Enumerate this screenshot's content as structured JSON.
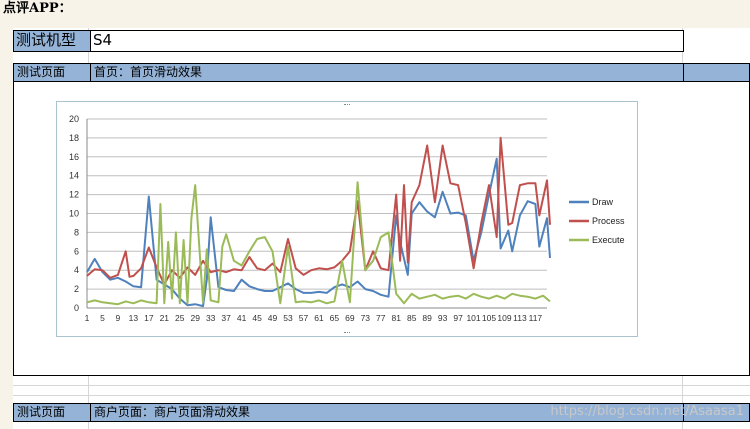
{
  "heading": "点评APP：",
  "table": {
    "model_label": "测试机型",
    "model_value": "S4",
    "page1_label": "测试页面",
    "page1_value": "首页：首页滑动效果",
    "page2_label": "测试页面",
    "page2_value": "商户页面：商户页面滑动效果"
  },
  "watermark": "https://blog.csdn.net/Asaasa1",
  "chart_data": {
    "type": "line",
    "title": "",
    "xlabel": "",
    "ylabel": "",
    "ylim": [
      0,
      20
    ],
    "yticks": [
      0,
      2,
      4,
      6,
      8,
      10,
      12,
      14,
      16,
      18,
      20
    ],
    "xlim": [
      1,
      120
    ],
    "xticks": [
      1,
      5,
      9,
      13,
      17,
      21,
      25,
      29,
      33,
      37,
      41,
      45,
      49,
      53,
      57,
      61,
      65,
      69,
      73,
      77,
      81,
      85,
      89,
      93,
      97,
      101,
      105,
      109,
      113,
      117
    ],
    "grid": true,
    "legend": "right",
    "series": [
      {
        "name": "Draw",
        "color": "#4f81bd",
        "points": [
          [
            1,
            3.8
          ],
          [
            3,
            5.2
          ],
          [
            5,
            3.8
          ],
          [
            7,
            3.0
          ],
          [
            9,
            3.2
          ],
          [
            11,
            2.8
          ],
          [
            13,
            2.3
          ],
          [
            15,
            2.2
          ],
          [
            17,
            11.8
          ],
          [
            19,
            3.0
          ],
          [
            21,
            2.5
          ],
          [
            23,
            2.0
          ],
          [
            25,
            1.0
          ],
          [
            27,
            0.3
          ],
          [
            29,
            0.4
          ],
          [
            31,
            0.2
          ],
          [
            32,
            3.0
          ],
          [
            33,
            9.6
          ],
          [
            35,
            2.2
          ],
          [
            37,
            1.9
          ],
          [
            39,
            1.8
          ],
          [
            41,
            3.0
          ],
          [
            43,
            2.3
          ],
          [
            45,
            2.0
          ],
          [
            47,
            1.8
          ],
          [
            49,
            1.8
          ],
          [
            51,
            2.2
          ],
          [
            53,
            2.6
          ],
          [
            55,
            2.0
          ],
          [
            57,
            1.6
          ],
          [
            59,
            1.6
          ],
          [
            61,
            1.7
          ],
          [
            63,
            1.6
          ],
          [
            65,
            2.2
          ],
          [
            67,
            2.5
          ],
          [
            69,
            2.2
          ],
          [
            71,
            2.8
          ],
          [
            73,
            2.0
          ],
          [
            75,
            1.8
          ],
          [
            77,
            1.4
          ],
          [
            79,
            1.2
          ],
          [
            81,
            9.8
          ],
          [
            82,
            7.0
          ],
          [
            84,
            3.5
          ],
          [
            85,
            10.0
          ],
          [
            87,
            11.2
          ],
          [
            89,
            10.2
          ],
          [
            91,
            9.6
          ],
          [
            93,
            12.3
          ],
          [
            95,
            10.0
          ],
          [
            97,
            10.1
          ],
          [
            99,
            9.8
          ],
          [
            101,
            5.0
          ],
          [
            103,
            8.0
          ],
          [
            105,
            12.0
          ],
          [
            107,
            15.8
          ],
          [
            108,
            6.3
          ],
          [
            110,
            8.2
          ],
          [
            111,
            6.0
          ],
          [
            113,
            9.8
          ],
          [
            115,
            11.3
          ],
          [
            117,
            11.0
          ],
          [
            118,
            6.5
          ],
          [
            120,
            9.5
          ],
          [
            121,
            5.3
          ]
        ]
      },
      {
        "name": "Process",
        "color": "#c0504d",
        "points": [
          [
            1,
            3.4
          ],
          [
            3,
            4.1
          ],
          [
            5,
            4.0
          ],
          [
            7,
            3.2
          ],
          [
            9,
            3.5
          ],
          [
            11,
            6.0
          ],
          [
            12,
            3.3
          ],
          [
            13,
            3.4
          ],
          [
            15,
            4.2
          ],
          [
            17,
            6.4
          ],
          [
            19,
            4.3
          ],
          [
            21,
            2.5
          ],
          [
            23,
            4.0
          ],
          [
            25,
            3.2
          ],
          [
            27,
            4.3
          ],
          [
            29,
            3.5
          ],
          [
            31,
            5.0
          ],
          [
            33,
            3.8
          ],
          [
            35,
            4.0
          ],
          [
            37,
            3.8
          ],
          [
            39,
            4.1
          ],
          [
            41,
            4.0
          ],
          [
            43,
            5.4
          ],
          [
            45,
            4.2
          ],
          [
            47,
            4.0
          ],
          [
            49,
            4.7
          ],
          [
            51,
            3.8
          ],
          [
            53,
            7.3
          ],
          [
            55,
            4.2
          ],
          [
            57,
            3.5
          ],
          [
            59,
            4.0
          ],
          [
            61,
            4.2
          ],
          [
            63,
            4.1
          ],
          [
            65,
            4.3
          ],
          [
            67,
            5.0
          ],
          [
            69,
            6.0
          ],
          [
            71,
            11.3
          ],
          [
            73,
            4.0
          ],
          [
            75,
            6.0
          ],
          [
            77,
            4.2
          ],
          [
            79,
            4.0
          ],
          [
            81,
            12.0
          ],
          [
            82,
            5.0
          ],
          [
            83,
            13.0
          ],
          [
            84,
            4.8
          ],
          [
            85,
            11.2
          ],
          [
            87,
            13.0
          ],
          [
            89,
            17.2
          ],
          [
            91,
            11.2
          ],
          [
            93,
            17.2
          ],
          [
            95,
            13.2
          ],
          [
            97,
            13.0
          ],
          [
            99,
            9.0
          ],
          [
            101,
            4.2
          ],
          [
            103,
            9.0
          ],
          [
            105,
            13.0
          ],
          [
            107,
            7.5
          ],
          [
            108,
            18.0
          ],
          [
            110,
            8.8
          ],
          [
            111,
            9.0
          ],
          [
            113,
            13.0
          ],
          [
            115,
            13.2
          ],
          [
            117,
            13.2
          ],
          [
            118,
            9.8
          ],
          [
            120,
            13.5
          ],
          [
            121,
            8.8
          ]
        ]
      },
      {
        "name": "Execute",
        "color": "#9bbb59",
        "points": [
          [
            1,
            0.6
          ],
          [
            3,
            0.8
          ],
          [
            5,
            0.6
          ],
          [
            7,
            0.5
          ],
          [
            9,
            0.4
          ],
          [
            11,
            0.7
          ],
          [
            13,
            0.5
          ],
          [
            15,
            0.8
          ],
          [
            17,
            0.6
          ],
          [
            19,
            0.5
          ],
          [
            20,
            11.0
          ],
          [
            21,
            0.5
          ],
          [
            22,
            7.0
          ],
          [
            23,
            1.0
          ],
          [
            24,
            8.0
          ],
          [
            25,
            0.5
          ],
          [
            26,
            7.2
          ],
          [
            27,
            0.5
          ],
          [
            28,
            9.5
          ],
          [
            29,
            13.0
          ],
          [
            31,
            0.6
          ],
          [
            32,
            6.2
          ],
          [
            33,
            0.8
          ],
          [
            35,
            0.6
          ],
          [
            36,
            6.5
          ],
          [
            37,
            7.8
          ],
          [
            39,
            5.0
          ],
          [
            41,
            4.5
          ],
          [
            43,
            6.0
          ],
          [
            45,
            7.3
          ],
          [
            47,
            7.5
          ],
          [
            49,
            6.0
          ],
          [
            51,
            0.5
          ],
          [
            53,
            6.5
          ],
          [
            55,
            0.6
          ],
          [
            57,
            0.7
          ],
          [
            59,
            0.6
          ],
          [
            61,
            0.8
          ],
          [
            63,
            0.5
          ],
          [
            65,
            0.7
          ],
          [
            67,
            5.0
          ],
          [
            69,
            0.6
          ],
          [
            71,
            13.3
          ],
          [
            73,
            4.0
          ],
          [
            75,
            5.0
          ],
          [
            77,
            7.5
          ],
          [
            79,
            8.0
          ],
          [
            81,
            1.5
          ],
          [
            83,
            0.5
          ],
          [
            85,
            1.5
          ],
          [
            87,
            1.0
          ],
          [
            89,
            1.2
          ],
          [
            91,
            1.4
          ],
          [
            93,
            1.0
          ],
          [
            95,
            1.2
          ],
          [
            97,
            1.3
          ],
          [
            99,
            1.0
          ],
          [
            101,
            1.5
          ],
          [
            103,
            1.2
          ],
          [
            105,
            1.0
          ],
          [
            107,
            1.3
          ],
          [
            109,
            1.0
          ],
          [
            111,
            1.5
          ],
          [
            113,
            1.3
          ],
          [
            115,
            1.2
          ],
          [
            117,
            1.0
          ],
          [
            119,
            1.3
          ],
          [
            121,
            0.7
          ]
        ]
      }
    ]
  }
}
